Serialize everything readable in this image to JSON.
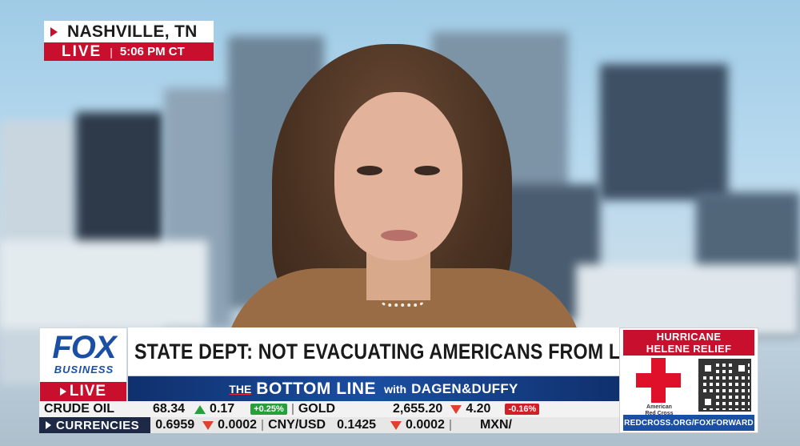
{
  "location": {
    "city": "NASHVILLE, TN",
    "live_label": "LIVE",
    "time": "5:06 PM CT"
  },
  "network": {
    "logo_main": "FOX",
    "logo_sub": "BUSINESS",
    "live_label": "LIVE"
  },
  "headline": {
    "text": "STATE DEPT: NOT EVACUATING AMERICANS FROM LEBANON"
  },
  "show": {
    "prefix": "THE",
    "name": "BOTTOM LINE",
    "with": "with",
    "hosts": "DAGEN&DUFFY"
  },
  "ticker_commodities": {
    "crude_label": "CRUDE OIL",
    "crude_value": "68.34",
    "crude_change": "0.17",
    "crude_pct": "+0.25%",
    "gold_label": "GOLD",
    "gold_value": "2,655.20",
    "gold_change": "4.20",
    "gold_pct": "-0.16%"
  },
  "ticker_currencies": {
    "label": "CURRENCIES",
    "first_value": "0.6959",
    "first_change": "0.0002",
    "pair_label": "CNY/USD",
    "pair_value": "0.1425",
    "pair_change": "0.0002",
    "next_label": "MXN/"
  },
  "promo": {
    "title_line1": "HURRICANE",
    "title_line2": "HELENE RELIEF",
    "org_line1": "American",
    "org_line2": "Red Cross",
    "url": "REDCROSS.ORG/FOXFORWARD"
  },
  "colors": {
    "fox_red": "#c8102e",
    "fox_blue": "#1b4fa6",
    "up_green": "#2a9d3c",
    "down_red": "#e0402c"
  }
}
